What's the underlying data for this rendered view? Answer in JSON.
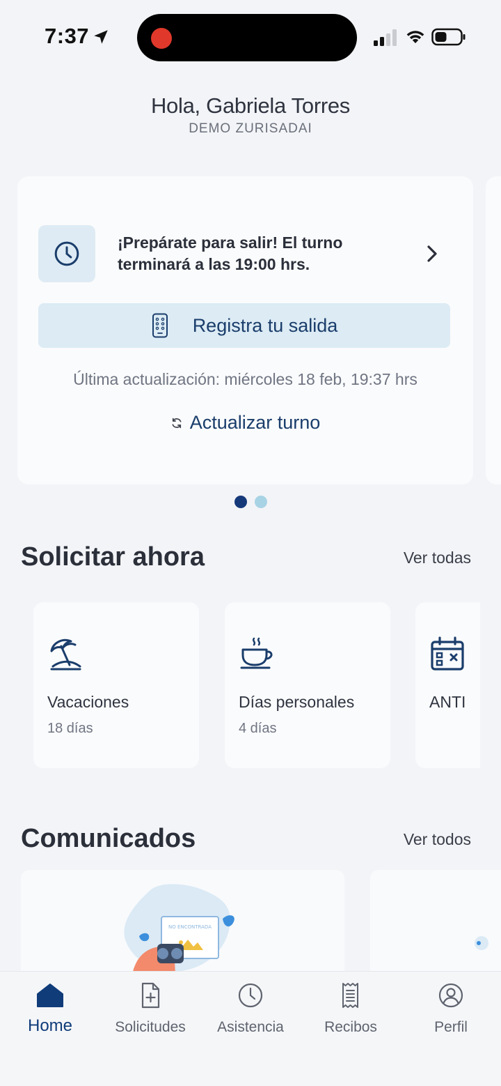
{
  "status_bar": {
    "time": "7:37",
    "icons": [
      "location-arrow-icon",
      "signal-icon",
      "wifi-icon",
      "battery-icon"
    ]
  },
  "greeting": {
    "name": "Hola, Gabriela Torres",
    "company": "DEMO ZURISADAI"
  },
  "shift_card": {
    "icon": "clock-icon",
    "message": "¡Prepárate para salir! El turno terminará a las 19:00 hrs.",
    "register_label": "Registra tu salida",
    "last_update": "Última actualización: miércoles 18 feb, 19:37 hrs",
    "refresh_label": "Actualizar turno",
    "carousel": {
      "pages": 2,
      "active_index": 0
    }
  },
  "requests": {
    "title": "Solicitar ahora",
    "see_all": "Ver todas",
    "items": [
      {
        "name": "Vacaciones",
        "days": "18 días",
        "icon": "beach-umbrella-icon"
      },
      {
        "name": "Días personales",
        "days": "4 días",
        "icon": "coffee-cup-icon"
      },
      {
        "name": "ANTI",
        "days": "",
        "icon": "calendar-x-icon"
      }
    ]
  },
  "news": {
    "title": "Comunicados",
    "see_all": "Ver todos",
    "image_text": "NO ENCONTRADA"
  },
  "bottom_nav": {
    "items": [
      {
        "label": "Home",
        "icon": "home-icon",
        "active": true
      },
      {
        "label": "Solicitudes",
        "icon": "document-plus-icon",
        "active": false
      },
      {
        "label": "Asistencia",
        "icon": "clock-icon",
        "active": false
      },
      {
        "label": "Recibos",
        "icon": "receipt-icon",
        "active": false
      },
      {
        "label": "Perfil",
        "icon": "user-circle-icon",
        "active": false
      }
    ]
  },
  "colors": {
    "primary": "#16397a",
    "accent_light": "#dcebf4",
    "dot_inactive": "#a8d3e5",
    "background": "#f3f4f7",
    "record": "#e0392b"
  }
}
